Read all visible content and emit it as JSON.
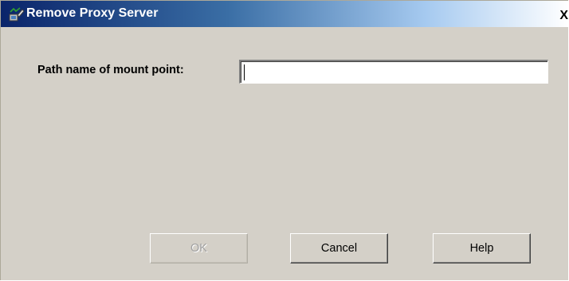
{
  "window": {
    "title": "Remove Proxy Server",
    "close_glyph": "X",
    "icon": "proxy-server-icon"
  },
  "form": {
    "mount_point_label": "Path name of mount point:",
    "mount_point_value": ""
  },
  "buttons": {
    "ok": {
      "label": "OK",
      "enabled": false
    },
    "cancel": {
      "label": "Cancel",
      "enabled": true
    },
    "help": {
      "label": "Help",
      "enabled": true
    }
  },
  "colors": {
    "dialog_background": "#d4d0c8",
    "titlebar_start": "#0a246a",
    "titlebar_end": "#ffffff"
  }
}
